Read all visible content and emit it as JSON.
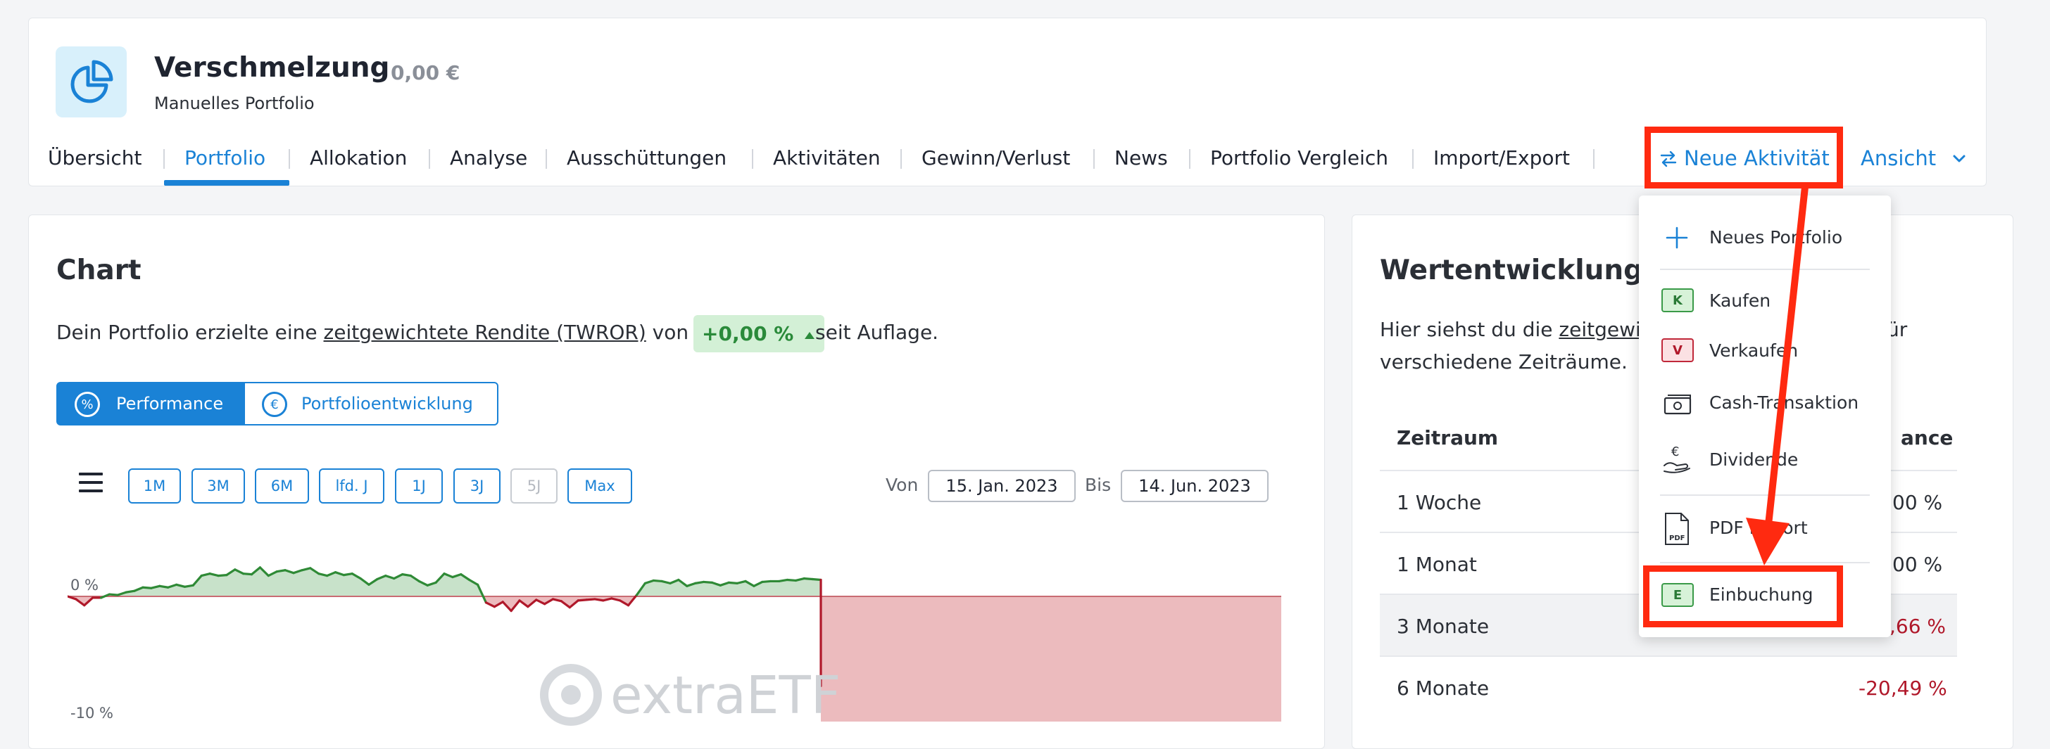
{
  "portfolio": {
    "title": "Verschmelzung",
    "value": "0,00 €",
    "subtitle": "Manuelles Portfolio"
  },
  "tabs": [
    {
      "label": "Übersicht"
    },
    {
      "label": "Portfolio"
    },
    {
      "label": "Allokation"
    },
    {
      "label": "Analyse"
    },
    {
      "label": "Ausschüttungen"
    },
    {
      "label": "Aktivitäten"
    },
    {
      "label": "Gewinn/Verlust"
    },
    {
      "label": "News"
    },
    {
      "label": "Portfolio Vergleich"
    },
    {
      "label": "Import/Export"
    }
  ],
  "actions": {
    "neue_aktivitaet": "Neue Aktivität",
    "ansicht": "Ansicht"
  },
  "chart_card": {
    "title": "Chart",
    "desc_prefix": "Dein Portfolio erzielte eine",
    "desc_link": "zeitgewichtete Rendite (TWROR)",
    "desc_mid": "von",
    "return_badge": "+0,00 %",
    "desc_suffix": "seit Auflage.",
    "toggle_performance": "Performance",
    "toggle_portfolio": "Portfolioentwicklung",
    "ranges": [
      "1M",
      "3M",
      "6M",
      "lfd. J",
      "1J",
      "3J",
      "5J",
      "Max"
    ],
    "von_label": "Von",
    "von_value": "15. Jan. 2023",
    "bis_label": "Bis",
    "bis_value": "14. Jun. 2023",
    "watermark": "extraETF"
  },
  "chart_data": {
    "type": "area",
    "yticks": [
      "0 %",
      "-10 %"
    ],
    "series": [
      {
        "values": [
          0.0,
          -0.4,
          -1.3,
          -0.2,
          -0.2,
          0.3,
          0.2,
          0.6,
          0.8,
          1.3,
          1.2,
          1.5,
          1.3,
          1.7,
          1.4,
          1.6,
          3.0,
          3.3,
          3.0,
          3.1,
          3.9,
          3.3,
          3.2,
          4.2,
          3.0,
          3.6,
          3.8,
          3.4,
          3.8,
          4.1,
          3.3,
          3.0,
          3.5,
          3.1,
          3.3,
          2.6,
          1.7,
          2.5,
          3.0,
          2.6,
          3.2,
          3.0,
          2.2,
          1.6,
          2.0,
          3.3,
          2.8,
          3.2,
          2.4,
          1.7,
          -0.9,
          -1.5,
          -0.8,
          -2.1,
          -0.6,
          -1.5,
          -0.5,
          -1.1,
          -0.4,
          -0.7,
          -1.6,
          -0.6,
          -0.5,
          -0.4,
          -0.6,
          -0.3,
          -0.6,
          -1.3,
          0.2,
          1.9,
          2.3,
          2.2,
          1.9,
          2.4,
          1.5,
          1.9,
          2.1,
          2.0,
          1.6,
          2.0,
          1.9,
          2.2,
          1.5,
          2.1,
          2.2,
          2.2,
          2.4,
          2.3,
          2.6,
          2.5,
          2.4,
          -13.0
        ]
      }
    ],
    "ylim": [
      -10.5,
      5.5
    ],
    "grid": false,
    "legend": "none"
  },
  "wertentwicklung": {
    "title": "Wertentwicklung",
    "desc_prefix": "Hier siehst du die",
    "desc_link": "zeitgewi",
    "desc_tail": "ür",
    "desc_line2": "verschiedene Zeiträume.",
    "col_zeitraum": "Zeitraum",
    "col_perf": "ance",
    "rows": [
      {
        "label": "1 Woche",
        "value": "00 %",
        "color": "#2b2f36"
      },
      {
        "label": "1 Monat",
        "value": "00 %",
        "color": "#2b2f36"
      },
      {
        "label": "3 Monate",
        "value": ",66 %",
        "color": "#b0182a"
      },
      {
        "label": "6 Monate",
        "value": "-20,49 %",
        "color": "#b0182a"
      }
    ]
  },
  "dropdown": {
    "neues_portfolio": "Neues Portfolio",
    "kaufen": "Kaufen",
    "kaufen_badge": "K",
    "verkaufen": "Verkaufen",
    "verkaufen_badge": "V",
    "cash": "Cash-Transaktion",
    "dividende": "Dividende",
    "pdf": "PDF Import",
    "pdf_icon_text": "PDF",
    "einbuchung": "Einbuchung",
    "einbuchung_badge": "E"
  },
  "colors": {
    "accent": "#1a82d6",
    "positive": "#2a8a3a",
    "negative": "#b0182a",
    "annotation": "#ff2a10"
  }
}
